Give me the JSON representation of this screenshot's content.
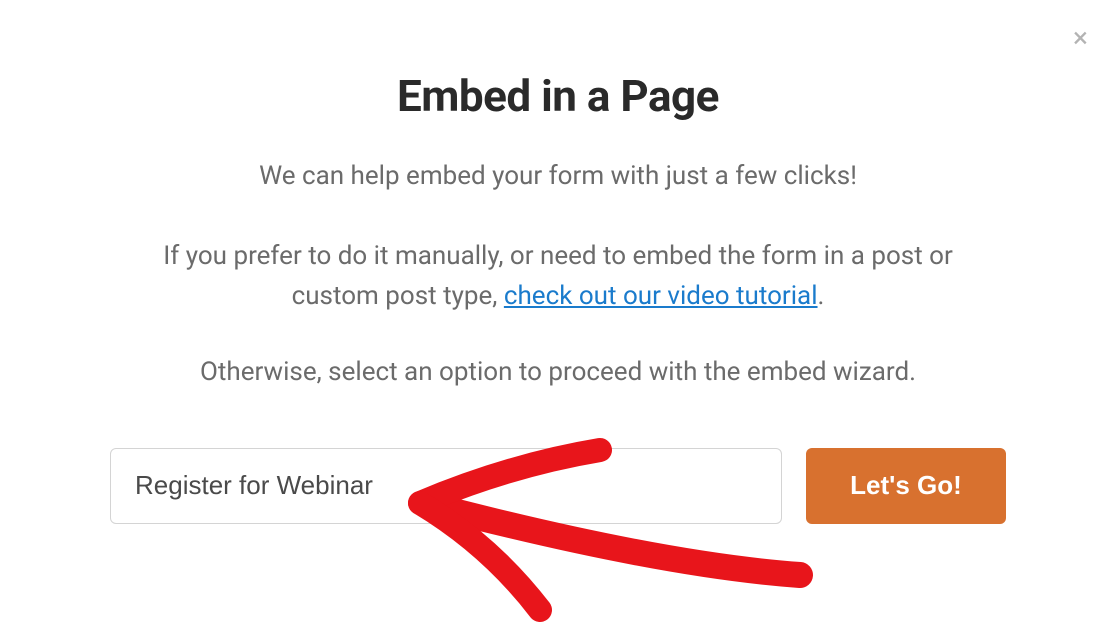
{
  "modal": {
    "close_glyph": "×",
    "title": "Embed in a Page",
    "subtitle": "We can help embed your form with just a few clicks!",
    "description_prefix": "If you prefer to do it manually, or need to embed the form in a post or custom post type, ",
    "description_link": "check out our video tutorial",
    "description_suffix": ".",
    "wizard_text": "Otherwise, select an option to proceed with the embed wizard.",
    "input_value": "Register for Webinar",
    "button_label": "Let's Go!"
  },
  "annotation": {
    "color": "#e8151b"
  }
}
